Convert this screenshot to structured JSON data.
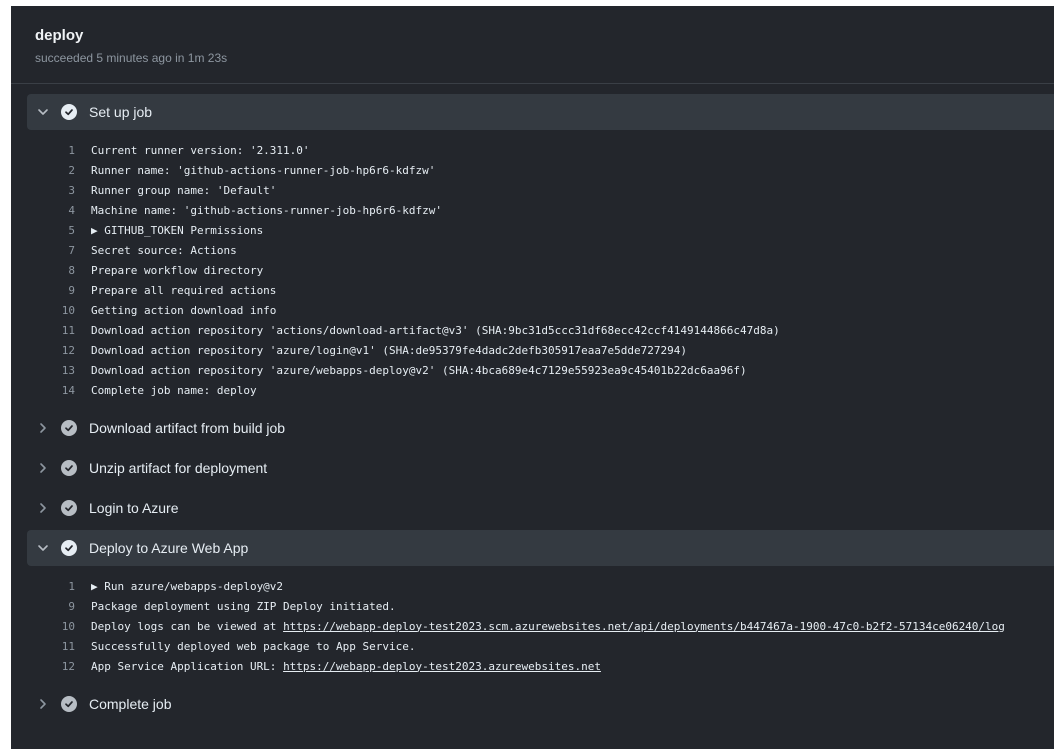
{
  "job": {
    "title": "deploy",
    "subtitle": "succeeded 5 minutes ago in 1m 23s"
  },
  "steps": [
    {
      "label": "Set up job",
      "expanded": true,
      "lines": [
        {
          "n": "1",
          "t": "Current runner version: '2.311.0'"
        },
        {
          "n": "2",
          "t": "Runner name: 'github-actions-runner-job-hp6r6-kdfzw'"
        },
        {
          "n": "3",
          "t": "Runner group name: 'Default'"
        },
        {
          "n": "4",
          "t": "Machine name: 'github-actions-runner-job-hp6r6-kdfzw'"
        },
        {
          "n": "5",
          "t": "▶ GITHUB_TOKEN Permissions"
        },
        {
          "n": "7",
          "t": "Secret source: Actions"
        },
        {
          "n": "8",
          "t": "Prepare workflow directory"
        },
        {
          "n": "9",
          "t": "Prepare all required actions"
        },
        {
          "n": "10",
          "t": "Getting action download info"
        },
        {
          "n": "11",
          "t": "Download action repository 'actions/download-artifact@v3' (SHA:9bc31d5ccc31df68ecc42ccf4149144866c47d8a)"
        },
        {
          "n": "12",
          "t": "Download action repository 'azure/login@v1' (SHA:de95379fe4dadc2defb305917eaa7e5dde727294)"
        },
        {
          "n": "13",
          "t": "Download action repository 'azure/webapps-deploy@v2' (SHA:4bca689e4c7129e55923ea9c45401b22dc6aa96f)"
        },
        {
          "n": "14",
          "t": "Complete job name: deploy"
        }
      ]
    },
    {
      "label": "Download artifact from build job",
      "expanded": false
    },
    {
      "label": "Unzip artifact for deployment",
      "expanded": false
    },
    {
      "label": "Login to Azure",
      "expanded": false
    },
    {
      "label": "Deploy to Azure Web App",
      "expanded": true,
      "lines": [
        {
          "n": "1",
          "t": "▶ Run azure/webapps-deploy@v2"
        },
        {
          "n": "9",
          "t": "Package deployment using ZIP Deploy initiated."
        },
        {
          "n": "10",
          "t": "Deploy logs can be viewed at ",
          "link": "https://webapp-deploy-test2023.scm.azurewebsites.net/api/deployments/b447467a-1900-47c0-b2f2-57134ce06240/log"
        },
        {
          "n": "11",
          "t": "Successfully deployed web package to App Service."
        },
        {
          "n": "12",
          "t": "App Service Application URL: ",
          "link": "https://webapp-deploy-test2023.azurewebsites.net"
        }
      ]
    },
    {
      "label": "Complete job",
      "expanded": false
    }
  ],
  "icons": {
    "expanded": "chevron-down-icon",
    "collapsed": "chevron-right-icon",
    "status": "check-circle-icon"
  },
  "colors": {
    "background": "#23262c",
    "expanded_step": "#343a41",
    "text": "#e6edf3",
    "muted": "#8d96a0"
  }
}
